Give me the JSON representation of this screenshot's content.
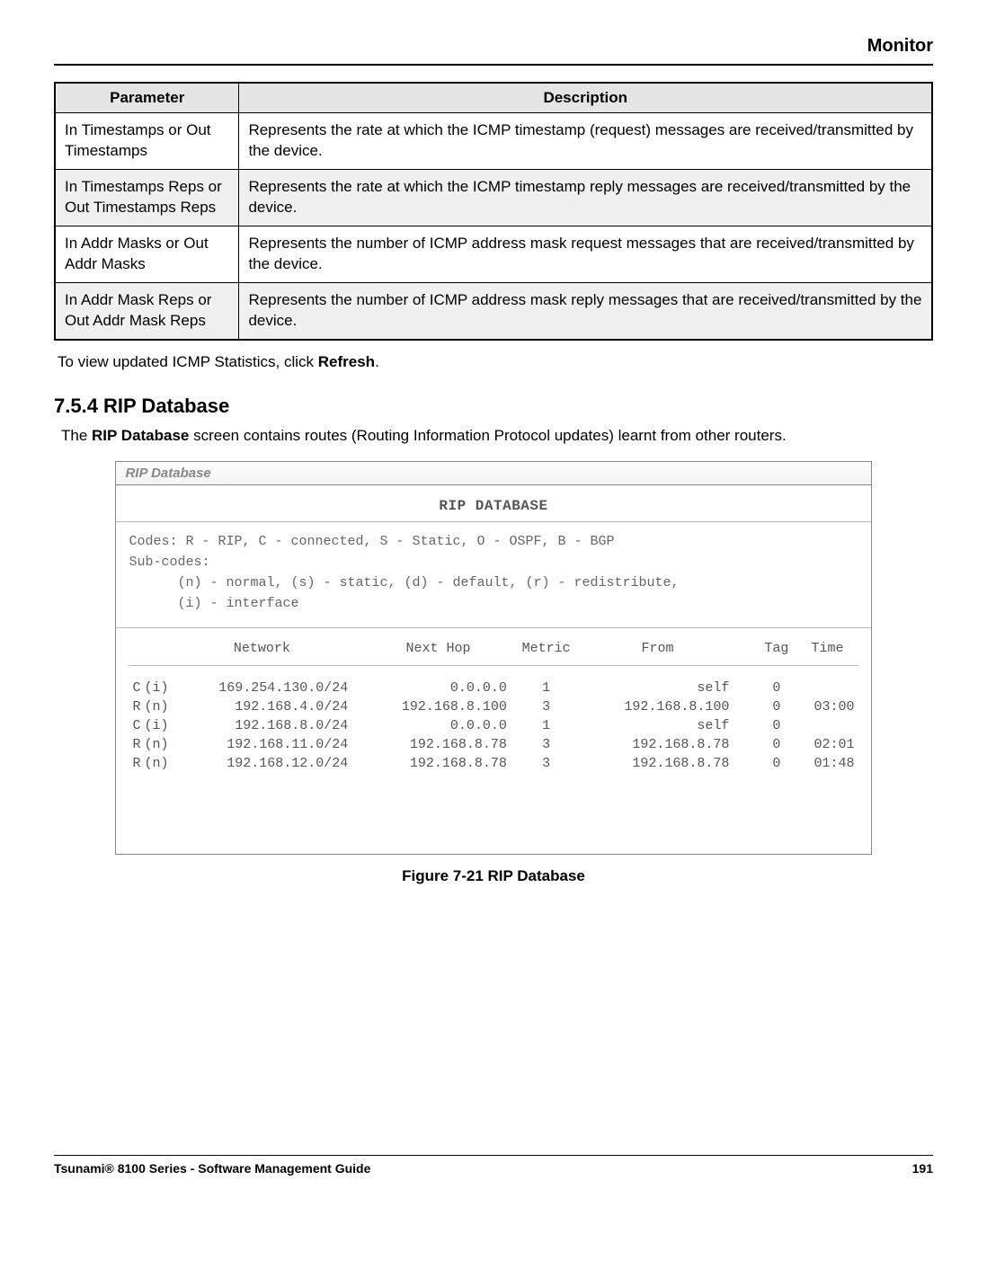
{
  "header": {
    "title": "Monitor"
  },
  "table": {
    "headers": {
      "parameter": "Parameter",
      "description": "Description"
    },
    "rows": [
      {
        "param": "In Timestamps or Out Timestamps",
        "desc": "Represents the rate at which the ICMP timestamp (request) messages are received/transmitted by the device."
      },
      {
        "param": "In Timestamps Reps or Out Timestamps Reps",
        "desc": "Represents the rate at which the ICMP timestamp reply messages are received/transmitted by the device."
      },
      {
        "param": "In Addr Masks or Out Addr Masks",
        "desc": "Represents the number of ICMP address mask request messages that are received/transmitted by the device."
      },
      {
        "param": "In Addr Mask Reps or Out Addr Mask Reps",
        "desc": "Represents the number of ICMP address mask reply messages that are received/transmitted by the device."
      }
    ]
  },
  "body_text": {
    "pre": "To view updated ICMP Statistics, click ",
    "bold": "Refresh",
    "post": "."
  },
  "section": {
    "heading": "7.5.4 RIP Database",
    "intro_pre": "The ",
    "intro_bold": "RIP Database",
    "intro_post": " screen contains routes (Routing Information Protocol updates) learnt from other routers."
  },
  "panel": {
    "title": "RIP Database",
    "rip_title": "RIP DATABASE",
    "legend": "Codes: R - RIP, C - connected, S - Static, O - OSPF, B - BGP\nSub-codes:\n      (n) - normal, (s) - static, (d) - default, (r) - redistribute,\n      (i) - interface",
    "columns": {
      "network": "Network",
      "nexthop": "Next Hop",
      "metric": "Metric",
      "from": "From",
      "tag": "Tag",
      "time": "Time"
    }
  },
  "chart_data": {
    "type": "table",
    "columns": [
      "code",
      "sub",
      "network",
      "next_hop",
      "metric",
      "from",
      "tag",
      "time"
    ],
    "rows": [
      {
        "code": "C",
        "sub": "(i)",
        "network": "169.254.130.0/24",
        "next_hop": "0.0.0.0",
        "metric": "1",
        "from": "self",
        "tag": "0",
        "time": ""
      },
      {
        "code": "R",
        "sub": "(n)",
        "network": "192.168.4.0/24",
        "next_hop": "192.168.8.100",
        "metric": "3",
        "from": "192.168.8.100",
        "tag": "0",
        "time": "03:00"
      },
      {
        "code": "C",
        "sub": "(i)",
        "network": "192.168.8.0/24",
        "next_hop": "0.0.0.0",
        "metric": "1",
        "from": "self",
        "tag": "0",
        "time": ""
      },
      {
        "code": "R",
        "sub": "(n)",
        "network": "192.168.11.0/24",
        "next_hop": "192.168.8.78",
        "metric": "3",
        "from": "192.168.8.78",
        "tag": "0",
        "time": "02:01"
      },
      {
        "code": "R",
        "sub": "(n)",
        "network": "192.168.12.0/24",
        "next_hop": "192.168.8.78",
        "metric": "3",
        "from": "192.168.8.78",
        "tag": "0",
        "time": "01:48"
      }
    ]
  },
  "figure_caption": "Figure 7-21 RIP Database",
  "footer": {
    "left": "Tsunami® 8100 Series - Software Management Guide",
    "right": "191"
  }
}
